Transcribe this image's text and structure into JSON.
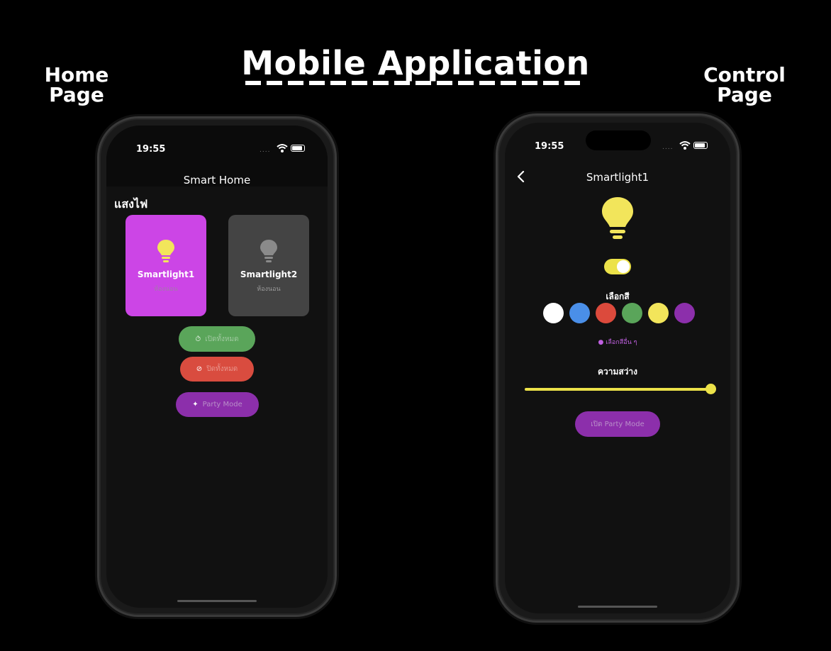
{
  "header": {
    "title": "Mobile Application",
    "left_label": "Home Page",
    "right_label": "Control Page"
  },
  "home": {
    "status_time": "19:55",
    "status_dots": "....",
    "nav_title": "Smart Home",
    "section_title": "แสงไฟ",
    "cards": [
      {
        "name": "Smartlight1",
        "room": "ห้องนอน",
        "color": "#cc45e6",
        "bulb_color": "#f2e55b"
      },
      {
        "name": "Smartlight2",
        "room": "ห้องนอน",
        "color": "#444444",
        "bulb_color": "#8a8a8a"
      }
    ],
    "buttons": {
      "on_label": "เปิดทั้งหมด",
      "off_label": "ปิดทั้งหมด",
      "party_label": "Party Mode"
    },
    "icons": {
      "on": "timer-icon",
      "off": "timer-off-icon",
      "party": "party-icon"
    }
  },
  "control": {
    "status_time": "19:55",
    "status_dots": "....",
    "nav_title": "Smartlight1",
    "back_icon": "chevron-left-icon",
    "bulb_color": "#f2e55b",
    "toggle_on": true,
    "color_label": "เลือกสี",
    "swatches": [
      "#ffffff",
      "#4a8fe8",
      "#dc4a3c",
      "#5aa55a",
      "#f2e55b",
      "#8c2fab"
    ],
    "more_colors_label": "เลือกสีอื่น ๆ",
    "brightness_label": "ความสว่าง",
    "brightness_fraction": 1.0,
    "party_label": "เปิด Party Mode"
  }
}
